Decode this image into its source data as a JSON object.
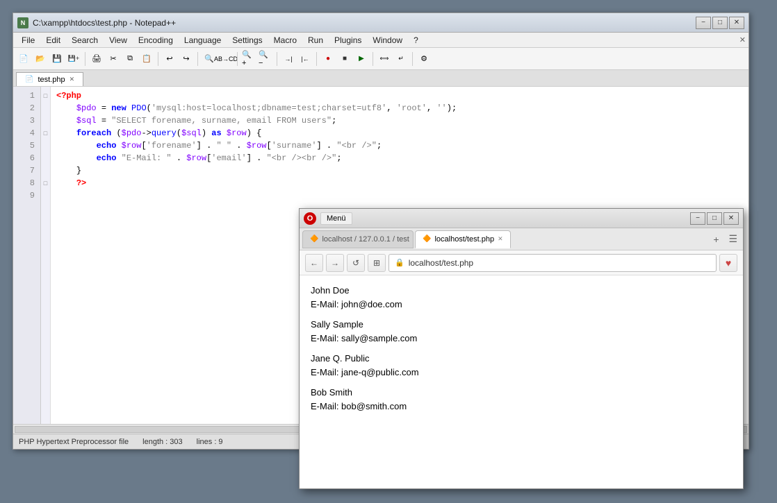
{
  "npp": {
    "titlebar": {
      "icon": "N",
      "title": "C:\\xampp\\htdocs\\test.php - Notepad++",
      "minimize": "−",
      "restore": "□",
      "close": "✕"
    },
    "menu": {
      "items": [
        "File",
        "Edit",
        "Search",
        "View",
        "Encoding",
        "Language",
        "Settings",
        "Macro",
        "Run",
        "Plugins",
        "Window",
        "?"
      ]
    },
    "tabs": [
      {
        "label": "test.php",
        "active": true
      }
    ],
    "code": {
      "lines": [
        {
          "num": "1",
          "fold": "─",
          "content": "<?php"
        },
        {
          "num": "2",
          "fold": " ",
          "content": "    $pdo = new PDO('mysql:host=localhost;dbname=test;charset=utf8', 'root', '');"
        },
        {
          "num": "3",
          "fold": " ",
          "content": "    $sql = \"SELECT forename, surname, email FROM users\";"
        },
        {
          "num": "4",
          "fold": "□",
          "content": "    foreach ($pdo->query($sql) as $row) {"
        },
        {
          "num": "5",
          "fold": " ",
          "content": "        echo $row['forename'] . \" \" . $row['surname'] . \"<br />\";"
        },
        {
          "num": "6",
          "fold": " ",
          "content": "        echo \"E-Mail: \" . $row['email'] . \"<br /><br />\";"
        },
        {
          "num": "7",
          "fold": " ",
          "content": "    }"
        },
        {
          "num": "8",
          "fold": "─",
          "content": "    ?>"
        },
        {
          "num": "9",
          "fold": " ",
          "content": ""
        }
      ]
    },
    "statusbar": {
      "filetype": "PHP Hypertext Preprocessor file",
      "length": "length : 303",
      "lines": "lines : 9"
    }
  },
  "opera": {
    "titlebar": {
      "menu_label": "Menü",
      "logo": "O",
      "minimize": "−",
      "restore": "□",
      "close": "✕"
    },
    "tabs": [
      {
        "label": "localhost / 127.0.0.1 / test",
        "active": false,
        "icon": "🔶"
      },
      {
        "label": "localhost/test.php",
        "active": true,
        "icon": "🔶"
      }
    ],
    "addressbar": {
      "back": "←",
      "forward": "→",
      "reload": "↺",
      "pages": "⊞",
      "url": "localhost/test.php",
      "fav": "♥"
    },
    "content": {
      "entries": [
        {
          "name": "John Doe",
          "email": "E-Mail: john@doe.com"
        },
        {
          "name": "Sally Sample",
          "email": "E-Mail: sally@sample.com"
        },
        {
          "name": "Jane Q. Public",
          "email": "E-Mail: jane-q@public.com"
        },
        {
          "name": "Bob Smith",
          "email": "E-Mail: bob@smith.com"
        }
      ]
    }
  }
}
